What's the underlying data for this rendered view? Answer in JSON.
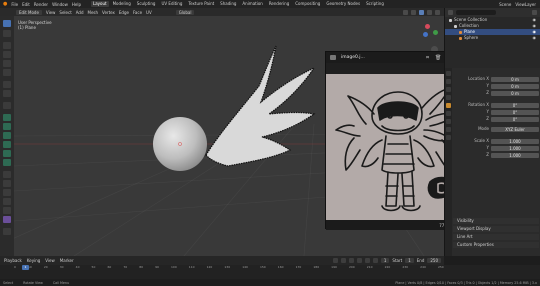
{
  "app": {
    "name": "Blender"
  },
  "menu": [
    "File",
    "Edit",
    "Render",
    "Window",
    "Help"
  ],
  "workspaces": [
    {
      "label": "Layout",
      "active": true
    },
    {
      "label": "Modeling",
      "active": false
    },
    {
      "label": "Sculpting",
      "active": false
    },
    {
      "label": "UV Editing",
      "active": false
    },
    {
      "label": "Texture Paint",
      "active": false
    },
    {
      "label": "Shading",
      "active": false
    },
    {
      "label": "Animation",
      "active": false
    },
    {
      "label": "Rendering",
      "active": false
    },
    {
      "label": "Compositing",
      "active": false
    },
    {
      "label": "Geometry Nodes",
      "active": false
    },
    {
      "label": "Scripting",
      "active": false
    }
  ],
  "scene": {
    "label": "Scene",
    "view_layer": "ViewLayer"
  },
  "viewport_header": {
    "mode": "Edit Mode",
    "menus": [
      "View",
      "Select",
      "Add",
      "Mesh",
      "Vertex",
      "Edge",
      "Face",
      "UV"
    ],
    "transform": "Global"
  },
  "viewport_info": {
    "line1": "User Perspective",
    "line2": "(1) Plane"
  },
  "outliner": {
    "rows": [
      {
        "label": "Scene Collection",
        "indent": 0,
        "selected": false,
        "color": "#cfcfcf"
      },
      {
        "label": "Collection",
        "indent": 1,
        "selected": false,
        "color": "#cfcfcf"
      },
      {
        "label": "Plane",
        "indent": 2,
        "selected": true,
        "color": "#e08a3a"
      },
      {
        "label": "Sphere",
        "indent": 2,
        "selected": false,
        "color": "#e08a3a"
      }
    ]
  },
  "properties": {
    "rows": [
      {
        "label": "Location X",
        "value": "0 m"
      },
      {
        "label": "Y",
        "value": "0 m"
      },
      {
        "label": "Z",
        "value": "0 m"
      },
      {
        "label": "Rotation X",
        "value": "0°"
      },
      {
        "label": "Y",
        "value": "0°"
      },
      {
        "label": "Z",
        "value": "0°"
      },
      {
        "label": "Mode",
        "value": "XYZ Euler"
      },
      {
        "label": "Scale X",
        "value": "1.000"
      },
      {
        "label": "Y",
        "value": "1.000"
      },
      {
        "label": "Z",
        "value": "1.000"
      }
    ],
    "sections": [
      "Visibility",
      "Viewport Display",
      "Line Art",
      "Custom Properties"
    ]
  },
  "image_viewer": {
    "title": "image0.j...",
    "zoom": "77%",
    "icons": [
      "crop-icon",
      "delete-icon",
      "heart-icon",
      "more-icon",
      "close-icon"
    ]
  },
  "timeline": {
    "menus": [
      "Playback",
      "Keying",
      "View",
      "Marker"
    ],
    "current_frame": "1",
    "start_label": "Start",
    "start": "1",
    "end_label": "End",
    "end": "250",
    "ticks": [
      "0",
      "10",
      "20",
      "30",
      "40",
      "50",
      "60",
      "70",
      "80",
      "90",
      "100",
      "110",
      "120",
      "130",
      "140",
      "150",
      "160",
      "170",
      "180",
      "190",
      "200",
      "210",
      "220",
      "230",
      "240",
      "250"
    ]
  },
  "statusbar": {
    "hints": [
      "Select",
      "Rotate View",
      "Call Menu"
    ],
    "stats": "Plane | Verts 0/8 | Edges 0/10 | Faces 0/3 | Tris 0 | Objects 1/2 | Memory 25.6 MiB | 3.x"
  },
  "colors": {
    "accent": "#4772b3",
    "viewport_bg": "#393939",
    "selected_row": "#334d80",
    "sketch_bg": "#b3aaa8",
    "ink": "#1a1a1a"
  }
}
